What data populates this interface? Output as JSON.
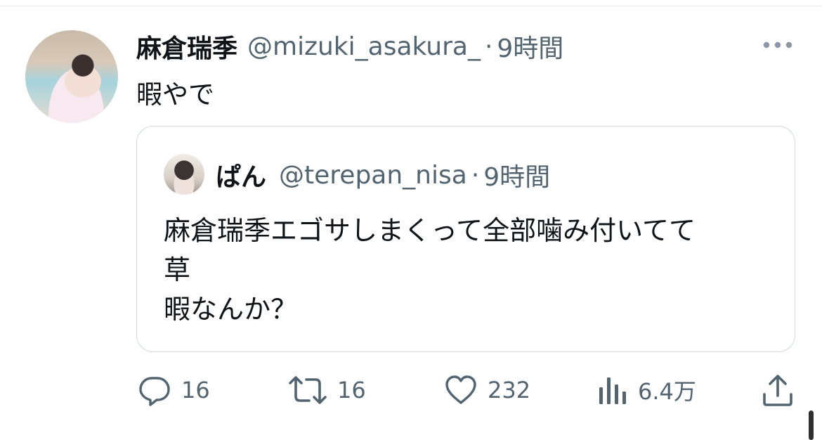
{
  "tweet": {
    "display_name": "麻倉瑞季",
    "handle": "@mizuki_asakura_",
    "separator": "·",
    "time": "9時間",
    "text": "暇やで"
  },
  "quote": {
    "display_name": "ぱん",
    "handle": "@terepan_nisa",
    "separator": "·",
    "time": "9時間",
    "lines": [
      "麻倉瑞季エゴサしまくって全部噛み付いてて",
      "草",
      "暇なんか？"
    ]
  },
  "actions": {
    "replies": "16",
    "retweets": "16",
    "likes": "232",
    "views": "6.4万"
  },
  "icons": {
    "more": "more-icon",
    "reply": "reply-icon",
    "retweet": "retweet-icon",
    "like": "heart-icon",
    "views": "analytics-icon",
    "share": "share-icon"
  },
  "colors": {
    "text": "#0f1419",
    "secondary": "#536471",
    "border": "#cfd9de"
  }
}
